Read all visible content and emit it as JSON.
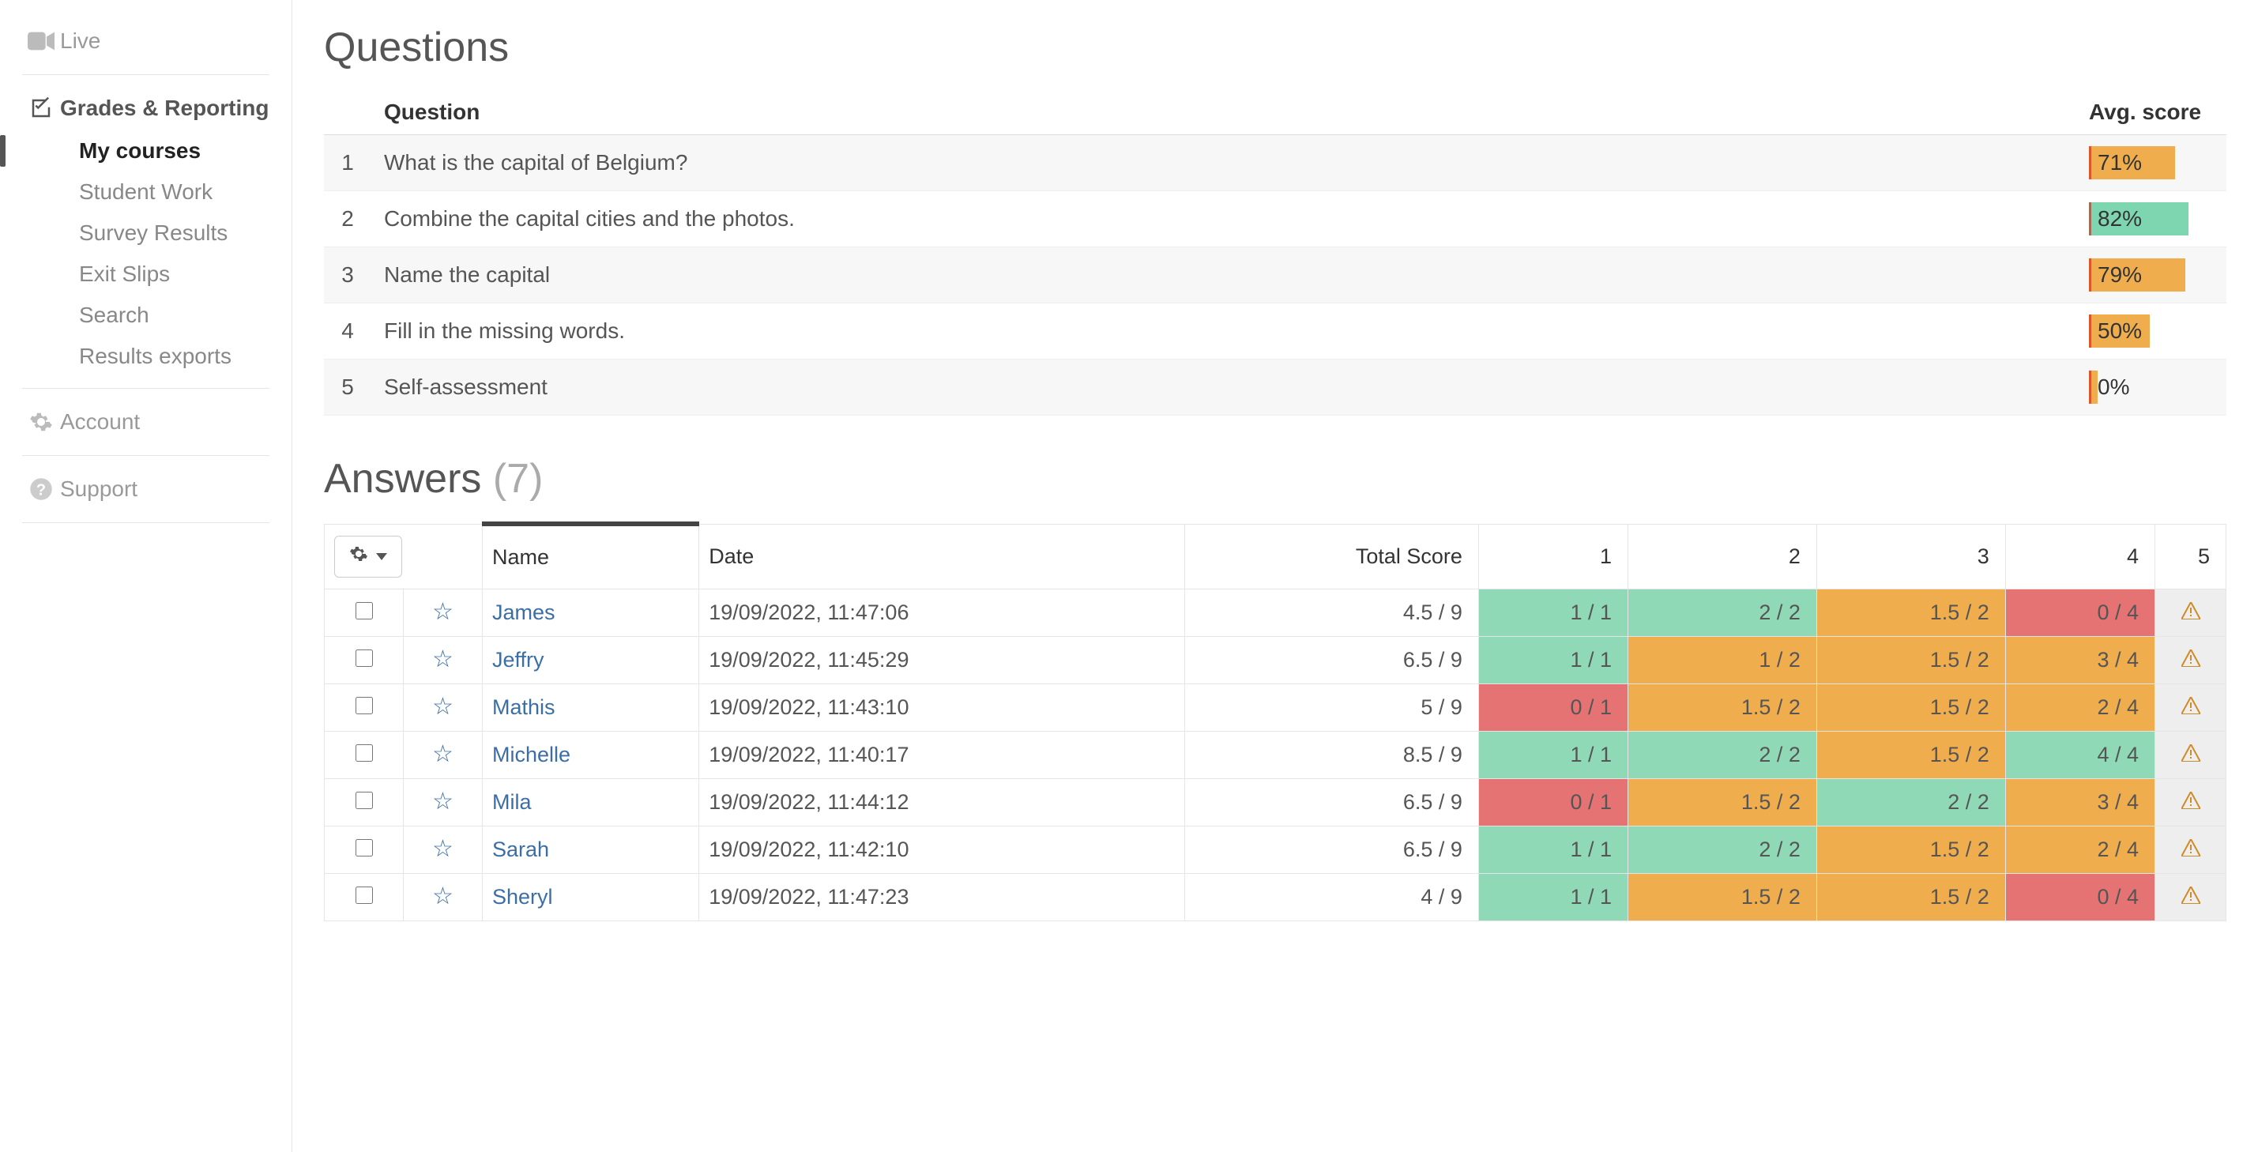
{
  "sidebar": {
    "live": "Live",
    "grades": "Grades & Reporting",
    "subs": [
      "My courses",
      "Student Work",
      "Survey Results",
      "Exit Slips",
      "Search",
      "Results exports"
    ],
    "account": "Account",
    "support": "Support"
  },
  "questions_title": "Questions",
  "q_headers": {
    "question": "Question",
    "avg": "Avg. score"
  },
  "questions": [
    {
      "n": "1",
      "text": "What is the capital of Belgium?",
      "score": "71%",
      "pct": 71,
      "color": "#f0ad4e"
    },
    {
      "n": "2",
      "text": "Combine the capital cities and the photos.",
      "score": "82%",
      "pct": 82,
      "color": "#7ed6b0"
    },
    {
      "n": "3",
      "text": "Name the capital",
      "score": "79%",
      "pct": 79,
      "color": "#f0ad4e"
    },
    {
      "n": "4",
      "text": "Fill in the missing words.",
      "score": "50%",
      "pct": 50,
      "color": "#f0ad4e"
    },
    {
      "n": "5",
      "text": "Self-assessment",
      "score": "0%",
      "pct": 0,
      "color": "#f0ad4e"
    }
  ],
  "answers_title": "Answers",
  "answers_count": "(7)",
  "a_headers": {
    "name": "Name",
    "date": "Date",
    "total": "Total Score",
    "q1": "1",
    "q2": "2",
    "q3": "3",
    "q4": "4",
    "q5": "5"
  },
  "colors": {
    "green": "#8fd9b6",
    "orange": "#f0ad4e",
    "red": "#e57373",
    "grey": "#e6e6e6"
  },
  "answers": [
    {
      "name": "James",
      "date": "19/09/2022, 11:47:06",
      "total": "4.5 / 9",
      "cells": [
        {
          "v": "1 / 1",
          "c": "green"
        },
        {
          "v": "2 / 2",
          "c": "green"
        },
        {
          "v": "1.5 / 2",
          "c": "orange"
        },
        {
          "v": "0 / 4",
          "c": "red"
        },
        {
          "v": "",
          "c": "grey",
          "warn": true
        }
      ]
    },
    {
      "name": "Jeffry",
      "date": "19/09/2022, 11:45:29",
      "total": "6.5 / 9",
      "cells": [
        {
          "v": "1 / 1",
          "c": "green"
        },
        {
          "v": "1 / 2",
          "c": "orange"
        },
        {
          "v": "1.5 / 2",
          "c": "orange"
        },
        {
          "v": "3 / 4",
          "c": "orange"
        },
        {
          "v": "",
          "c": "grey",
          "warn": true
        }
      ]
    },
    {
      "name": "Mathis",
      "date": "19/09/2022, 11:43:10",
      "total": "5 / 9",
      "cells": [
        {
          "v": "0 / 1",
          "c": "red"
        },
        {
          "v": "1.5 / 2",
          "c": "orange"
        },
        {
          "v": "1.5 / 2",
          "c": "orange"
        },
        {
          "v": "2 / 4",
          "c": "orange"
        },
        {
          "v": "",
          "c": "grey",
          "warn": true
        }
      ]
    },
    {
      "name": "Michelle",
      "date": "19/09/2022, 11:40:17",
      "total": "8.5 / 9",
      "cells": [
        {
          "v": "1 / 1",
          "c": "green"
        },
        {
          "v": "2 / 2",
          "c": "green"
        },
        {
          "v": "1.5 / 2",
          "c": "orange"
        },
        {
          "v": "4 / 4",
          "c": "green"
        },
        {
          "v": "",
          "c": "grey",
          "warn": true
        }
      ]
    },
    {
      "name": "Mila",
      "date": "19/09/2022, 11:44:12",
      "total": "6.5 / 9",
      "cells": [
        {
          "v": "0 / 1",
          "c": "red"
        },
        {
          "v": "1.5 / 2",
          "c": "orange"
        },
        {
          "v": "2 / 2",
          "c": "green"
        },
        {
          "v": "3 / 4",
          "c": "orange"
        },
        {
          "v": "",
          "c": "grey",
          "warn": true
        }
      ]
    },
    {
      "name": "Sarah",
      "date": "19/09/2022, 11:42:10",
      "total": "6.5 / 9",
      "cells": [
        {
          "v": "1 / 1",
          "c": "green"
        },
        {
          "v": "2 / 2",
          "c": "green"
        },
        {
          "v": "1.5 / 2",
          "c": "orange"
        },
        {
          "v": "2 / 4",
          "c": "orange"
        },
        {
          "v": "",
          "c": "grey",
          "warn": true
        }
      ]
    },
    {
      "name": "Sheryl",
      "date": "19/09/2022, 11:47:23",
      "total": "4 / 9",
      "cells": [
        {
          "v": "1 / 1",
          "c": "green"
        },
        {
          "v": "1.5 / 2",
          "c": "orange"
        },
        {
          "v": "1.5 / 2",
          "c": "orange"
        },
        {
          "v": "0 / 4",
          "c": "red"
        },
        {
          "v": "",
          "c": "grey",
          "warn": true
        }
      ]
    }
  ],
  "chart_data": {
    "type": "table",
    "title": "Questions average score",
    "categories": [
      "What is the capital of Belgium?",
      "Combine the capital cities and the photos.",
      "Name the capital",
      "Fill in the missing words.",
      "Self-assessment"
    ],
    "values": [
      71,
      82,
      79,
      50,
      0
    ],
    "ylabel": "Avg. score (%)",
    "ylim": [
      0,
      100
    ]
  }
}
